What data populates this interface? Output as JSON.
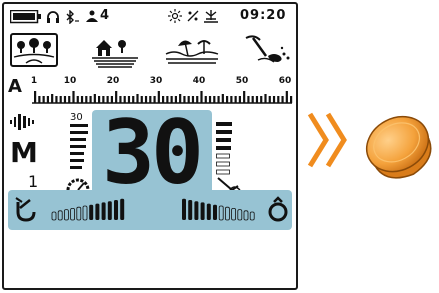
{
  "status": {
    "time": "09:20",
    "channel": "4"
  },
  "modes": [
    {
      "name": "park-mode",
      "icon": "park-icon"
    },
    {
      "name": "field-mode",
      "icon": "field-icon"
    },
    {
      "name": "beach-mode",
      "icon": "beach-icon"
    },
    {
      "name": "gold-mode",
      "icon": "gold-pick-icon"
    }
  ],
  "scale": {
    "range_letter": "A",
    "ticks": [
      "1",
      "10",
      "20",
      "30",
      "40",
      "50",
      "60"
    ]
  },
  "readout": {
    "target_id": "30",
    "mode_letter": "M",
    "mode_number": "1",
    "depth_label": "30"
  },
  "colors": {
    "lcd_highlight": "#97c3d3",
    "arrow": "#f08c1e",
    "cap": "#f4a23c"
  }
}
